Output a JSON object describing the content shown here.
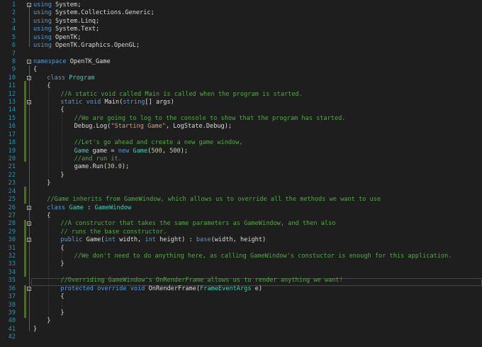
{
  "editor": {
    "lines": [
      {
        "n": "1",
        "indent": 0,
        "fold": true,
        "tokens": [
          {
            "c": "kw",
            "t": "using"
          },
          {
            "c": "",
            "t": " System;"
          }
        ]
      },
      {
        "n": "2",
        "indent": 0,
        "tokens": [
          {
            "c": "kw",
            "t": "using"
          },
          {
            "c": "",
            "t": " System.Collections.Generic;"
          }
        ]
      },
      {
        "n": "3",
        "indent": 0,
        "tokens": [
          {
            "c": "kw",
            "t": "using"
          },
          {
            "c": "",
            "t": " System.Linq;"
          }
        ]
      },
      {
        "n": "4",
        "indent": 0,
        "tokens": [
          {
            "c": "kw",
            "t": "using"
          },
          {
            "c": "",
            "t": " System.Text;"
          }
        ]
      },
      {
        "n": "5",
        "indent": 0,
        "tokens": [
          {
            "c": "kw",
            "t": "using"
          },
          {
            "c": "",
            "t": " OpenTK;"
          }
        ]
      },
      {
        "n": "6",
        "indent": 0,
        "tokens": [
          {
            "c": "kw",
            "t": "using"
          },
          {
            "c": "",
            "t": " OpenTK.Graphics.OpenGL;"
          }
        ]
      },
      {
        "n": "7",
        "indent": 0,
        "tokens": []
      },
      {
        "n": "8",
        "indent": 0,
        "fold": true,
        "tokens": [
          {
            "c": "kw",
            "t": "namespace"
          },
          {
            "c": "",
            "t": " OpenTK_Game"
          }
        ]
      },
      {
        "n": "9",
        "indent": 0,
        "tokens": [
          {
            "c": "",
            "t": "{"
          }
        ]
      },
      {
        "n": "10",
        "indent": 1,
        "fold": true,
        "tokens": [
          {
            "c": "kw",
            "t": "class"
          },
          {
            "c": "",
            "t": " "
          },
          {
            "c": "ty",
            "t": "Program"
          }
        ]
      },
      {
        "n": "11",
        "indent": 1,
        "tokens": [
          {
            "c": "",
            "t": "{"
          }
        ]
      },
      {
        "n": "12",
        "indent": 2,
        "tokens": [
          {
            "c": "cm",
            "t": "//A static void called Main is called when the program is started."
          }
        ]
      },
      {
        "n": "13",
        "indent": 2,
        "fold": true,
        "tokens": [
          {
            "c": "kw",
            "t": "static"
          },
          {
            "c": "",
            "t": " "
          },
          {
            "c": "kw",
            "t": "void"
          },
          {
            "c": "",
            "t": " Main("
          },
          {
            "c": "kw",
            "t": "string"
          },
          {
            "c": "",
            "t": "[] args)"
          }
        ]
      },
      {
        "n": "14",
        "indent": 2,
        "tokens": [
          {
            "c": "",
            "t": "{"
          }
        ]
      },
      {
        "n": "15",
        "indent": 3,
        "tokens": [
          {
            "c": "cm",
            "t": "//We are going to log to the console to show that the program has started."
          }
        ]
      },
      {
        "n": "16",
        "indent": 3,
        "tokens": [
          {
            "c": "",
            "t": "Debug.Log("
          },
          {
            "c": "st",
            "t": "\"Starting Game\""
          },
          {
            "c": "",
            "t": ", LogState.Debug);"
          }
        ]
      },
      {
        "n": "17",
        "indent": 3,
        "tokens": []
      },
      {
        "n": "18",
        "indent": 3,
        "tokens": [
          {
            "c": "cm",
            "t": "//Let's go ahead and create a new game window,"
          }
        ]
      },
      {
        "n": "19",
        "indent": 3,
        "tokens": [
          {
            "c": "ty",
            "t": "Game"
          },
          {
            "c": "",
            "t": " game = "
          },
          {
            "c": "kw",
            "t": "new"
          },
          {
            "c": "",
            "t": " "
          },
          {
            "c": "ty",
            "t": "Game"
          },
          {
            "c": "",
            "t": "("
          },
          {
            "c": "nm",
            "t": "500"
          },
          {
            "c": "",
            "t": ", "
          },
          {
            "c": "nm",
            "t": "500"
          },
          {
            "c": "",
            "t": ");"
          }
        ]
      },
      {
        "n": "20",
        "indent": 3,
        "tokens": [
          {
            "c": "cm",
            "t": "//and run it."
          }
        ]
      },
      {
        "n": "21",
        "indent": 3,
        "tokens": [
          {
            "c": "",
            "t": "game.Run("
          },
          {
            "c": "nm",
            "t": "30.0"
          },
          {
            "c": "",
            "t": ");"
          }
        ]
      },
      {
        "n": "22",
        "indent": 2,
        "tokens": [
          {
            "c": "",
            "t": "}"
          }
        ]
      },
      {
        "n": "23",
        "indent": 1,
        "tokens": [
          {
            "c": "",
            "t": "}"
          }
        ]
      },
      {
        "n": "24",
        "indent": 1,
        "tokens": []
      },
      {
        "n": "25",
        "indent": 1,
        "tokens": [
          {
            "c": "cm",
            "t": "//Game inherits from GameWindow, which allows us to override all the methods we want to use"
          }
        ]
      },
      {
        "n": "26",
        "indent": 1,
        "fold": true,
        "tokens": [
          {
            "c": "kw",
            "t": "class"
          },
          {
            "c": "",
            "t": " "
          },
          {
            "c": "ty",
            "t": "Game"
          },
          {
            "c": "",
            "t": " : "
          },
          {
            "c": "ty",
            "t": "GameWindow"
          }
        ]
      },
      {
        "n": "27",
        "indent": 1,
        "tokens": [
          {
            "c": "",
            "t": "{"
          }
        ]
      },
      {
        "n": "28",
        "indent": 2,
        "fold": true,
        "tokens": [
          {
            "c": "cm",
            "t": "//A constructor that takes the same parameters as GameWindow, and then also"
          }
        ]
      },
      {
        "n": "29",
        "indent": 2,
        "tokens": [
          {
            "c": "cm",
            "t": "// runs the base constructor."
          }
        ]
      },
      {
        "n": "30",
        "indent": 2,
        "fold": true,
        "tokens": [
          {
            "c": "kw",
            "t": "public"
          },
          {
            "c": "",
            "t": " Game("
          },
          {
            "c": "kw",
            "t": "int"
          },
          {
            "c": "",
            "t": " width, "
          },
          {
            "c": "kw",
            "t": "int"
          },
          {
            "c": "",
            "t": " height) : "
          },
          {
            "c": "kw",
            "t": "base"
          },
          {
            "c": "",
            "t": "(width, height)"
          }
        ]
      },
      {
        "n": "31",
        "indent": 2,
        "tokens": [
          {
            "c": "",
            "t": "{"
          }
        ]
      },
      {
        "n": "32",
        "indent": 3,
        "tokens": [
          {
            "c": "cm",
            "t": "//We don't need to do anything here, as calling GameWindow's constuctor is enough for this application."
          }
        ]
      },
      {
        "n": "33",
        "indent": 2,
        "tokens": [
          {
            "c": "",
            "t": "}"
          }
        ]
      },
      {
        "n": "34",
        "indent": 2,
        "tokens": []
      },
      {
        "n": "35",
        "indent": 2,
        "current": true,
        "tokens": [
          {
            "c": "cm",
            "t": "//Overriding GameWindow's OnRenderFrame allows us to render anything we want!"
          }
        ]
      },
      {
        "n": "36",
        "indent": 2,
        "fold": true,
        "tokens": [
          {
            "c": "kw",
            "t": "protected"
          },
          {
            "c": "",
            "t": " "
          },
          {
            "c": "kw",
            "t": "override"
          },
          {
            "c": "",
            "t": " "
          },
          {
            "c": "kw",
            "t": "void"
          },
          {
            "c": "",
            "t": " OnRenderFrame("
          },
          {
            "c": "ty",
            "t": "FrameEventArgs"
          },
          {
            "c": "",
            "t": " e)"
          }
        ]
      },
      {
        "n": "37",
        "indent": 2,
        "tokens": [
          {
            "c": "",
            "t": "{"
          }
        ]
      },
      {
        "n": "38",
        "indent": 3,
        "tokens": []
      },
      {
        "n": "39",
        "indent": 2,
        "tokens": [
          {
            "c": "",
            "t": "}"
          }
        ]
      },
      {
        "n": "40",
        "indent": 1,
        "tokens": [
          {
            "c": "",
            "t": "}"
          }
        ]
      },
      {
        "n": "41",
        "indent": 0,
        "tokens": [
          {
            "c": "",
            "t": "}"
          }
        ]
      },
      {
        "n": "42",
        "indent": 0,
        "tokens": []
      }
    ]
  }
}
